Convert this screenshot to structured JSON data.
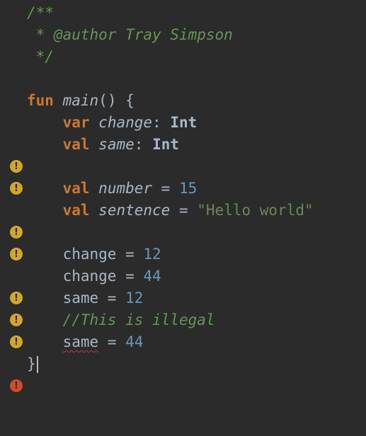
{
  "editor": {
    "language": "Kotlin",
    "theme_background": "#2b2b2b",
    "colors": {
      "keyword": "#cc7832",
      "comment": "#629755",
      "number": "#6897bb",
      "string": "#6a8759",
      "text": "#a9b7c6",
      "warning_icon": "#d1a72b",
      "error_icon": "#d44b2b"
    },
    "doc_open": "/**",
    "doc_author": " * @author Tray Simpson",
    "doc_close": " */",
    "kw_fun": "fun",
    "fn_main": "main",
    "fn_main_rest": "() {",
    "kw_var": "var",
    "kw_val": "val",
    "id_change": "change",
    "id_same": "same",
    "id_number": "number",
    "id_sentence": "sentence",
    "colon": ":",
    "type_int": "Int",
    "eq": " = ",
    "num_15": "15",
    "num_12": "12",
    "num_44": "44",
    "str_hello": "\"Hello world\"",
    "comment_illegal": "//This is illegal",
    "close_brace": "}",
    "warning_glyph": "!",
    "error_glyph": "!"
  }
}
